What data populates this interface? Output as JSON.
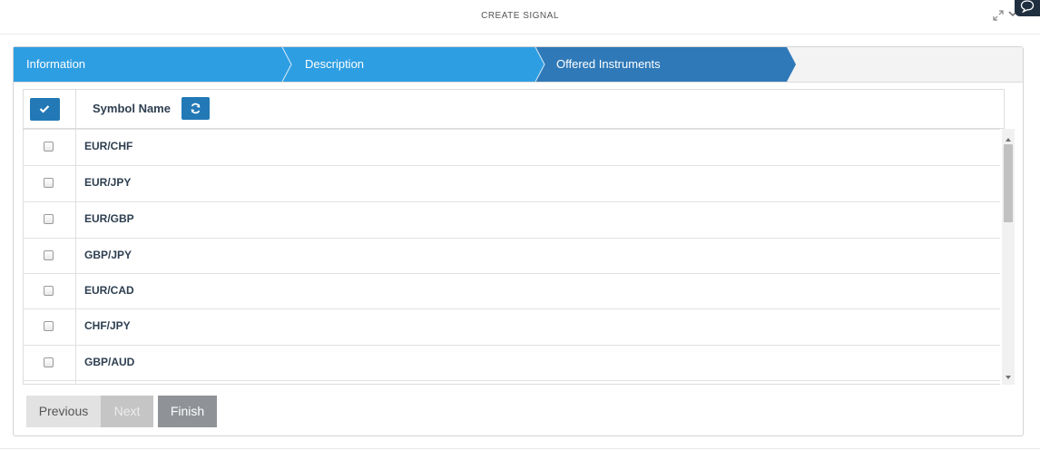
{
  "modal": {
    "title": "CREATE SIGNAL",
    "expand_icon": "expand-arrows-icon",
    "chevron_icon": "chevron-down-icon",
    "chat_icon": "chat-bubble-icon"
  },
  "wizard": {
    "steps": [
      {
        "label": "Information",
        "state": "completed"
      },
      {
        "label": "Description",
        "state": "completed"
      },
      {
        "label": "Offered Instruments",
        "state": "active"
      }
    ],
    "colors": {
      "completed": "#2e9ee3",
      "active": "#2f79b8",
      "inactive": "#f3f3f3"
    }
  },
  "grid": {
    "column_header": "Symbol Name",
    "check_all_icon": "checkmark-icon",
    "refresh_icon": "refresh-icon",
    "rows": [
      {
        "symbol": "EUR/CHF",
        "checked": false
      },
      {
        "symbol": "EUR/JPY",
        "checked": false
      },
      {
        "symbol": "EUR/GBP",
        "checked": false
      },
      {
        "symbol": "GBP/JPY",
        "checked": false
      },
      {
        "symbol": "EUR/CAD",
        "checked": false
      },
      {
        "symbol": "CHF/JPY",
        "checked": false
      },
      {
        "symbol": "GBP/AUD",
        "checked": false
      }
    ]
  },
  "buttons": {
    "previous": "Previous",
    "next": "Next",
    "finish": "Finish"
  }
}
